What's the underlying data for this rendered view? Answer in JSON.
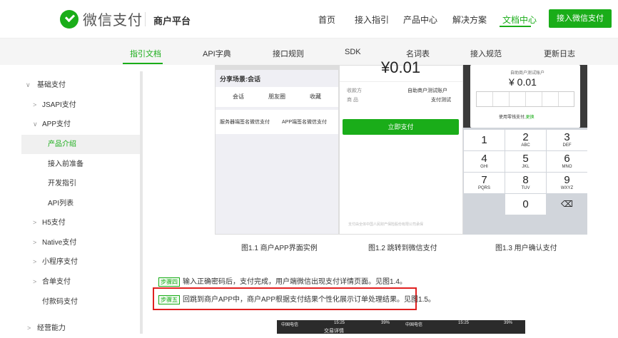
{
  "header": {
    "brand": "微信支付",
    "platform": "商户平台",
    "nav": [
      "首页",
      "接入指引",
      "产品中心",
      "解决方案",
      "文档中心"
    ],
    "active_nav": "文档中心",
    "cta": "接入微信支付"
  },
  "subnav": {
    "tabs": [
      "指引文档",
      "API字典",
      "接口规则",
      "SDK",
      "名词表",
      "接入规范",
      "更新日志"
    ],
    "active": "指引文档"
  },
  "sidebar": {
    "items": [
      {
        "label": "基础支付",
        "chev": "∨"
      },
      {
        "label": "JSAPI支付",
        "chev": ">"
      },
      {
        "label": "APP支付",
        "chev": "∨"
      },
      {
        "label": "产品介绍",
        "chev": ""
      },
      {
        "label": "接入前准备",
        "chev": ""
      },
      {
        "label": "开发指引",
        "chev": ""
      },
      {
        "label": "API列表",
        "chev": ""
      },
      {
        "label": "H5支付",
        "chev": ">"
      },
      {
        "label": "Native支付",
        "chev": ">"
      },
      {
        "label": "小程序支付",
        "chev": ">"
      },
      {
        "label": "合单支付",
        "chev": ">"
      },
      {
        "label": "付款码支付",
        "chev": ""
      },
      {
        "label": "经营能力",
        "chev": ">"
      }
    ],
    "active": "产品介绍"
  },
  "screenshots": {
    "shot1": {
      "title": "分享场景:会话",
      "opts": [
        "会话",
        "朋友圈",
        "收藏"
      ],
      "row": [
        "服务器端签名微信支付",
        "APP端签名微信支付"
      ]
    },
    "shot2": {
      "amount": "¥0.01",
      "payee_label": "收款方",
      "payee": "自助商户测试账户",
      "goods_label": "商    品",
      "goods": "支付测试",
      "pay_button": "立即支付",
      "footer": "支付由全体中国人民财产保险股份有限公司承保"
    },
    "shot3": {
      "payee": "自助商户测试账户",
      "amount": "¥ 0.01",
      "hint": "使用零钱支付,",
      "switch": "更换",
      "keys": [
        [
          "1",
          ""
        ],
        [
          "2",
          "ABC"
        ],
        [
          "3",
          "DEF"
        ],
        [
          "4",
          "GHI"
        ],
        [
          "5",
          "JKL"
        ],
        [
          "6",
          "MNO"
        ],
        [
          "7",
          "PQRS"
        ],
        [
          "8",
          "TUV"
        ],
        [
          "9",
          "WXYZ"
        ],
        [
          "",
          ""
        ],
        [
          "0",
          ""
        ],
        [
          "⌫",
          ""
        ]
      ]
    }
  },
  "captions": [
    "图1.1 商户APP界面实例",
    "图1.2 跳转到微信支付",
    "图1.3 用户确认支付"
  ],
  "steps": [
    {
      "badge": "步骤四",
      "text": "输入正确密码后，支付完成，用户端微信出现支付详情页面。见图1.4。"
    },
    {
      "badge": "步骤五",
      "text": "回跳到商户APP中，商户APP根据支付结果个性化展示订单处理结果。见图1.5。"
    }
  ],
  "phone_status": {
    "carrier": "中国电信",
    "time": "15:25",
    "battery": "39%",
    "title": "交易详情"
  },
  "colors": {
    "brand_green": "#1aad19",
    "highlight_red": "#e02020"
  }
}
